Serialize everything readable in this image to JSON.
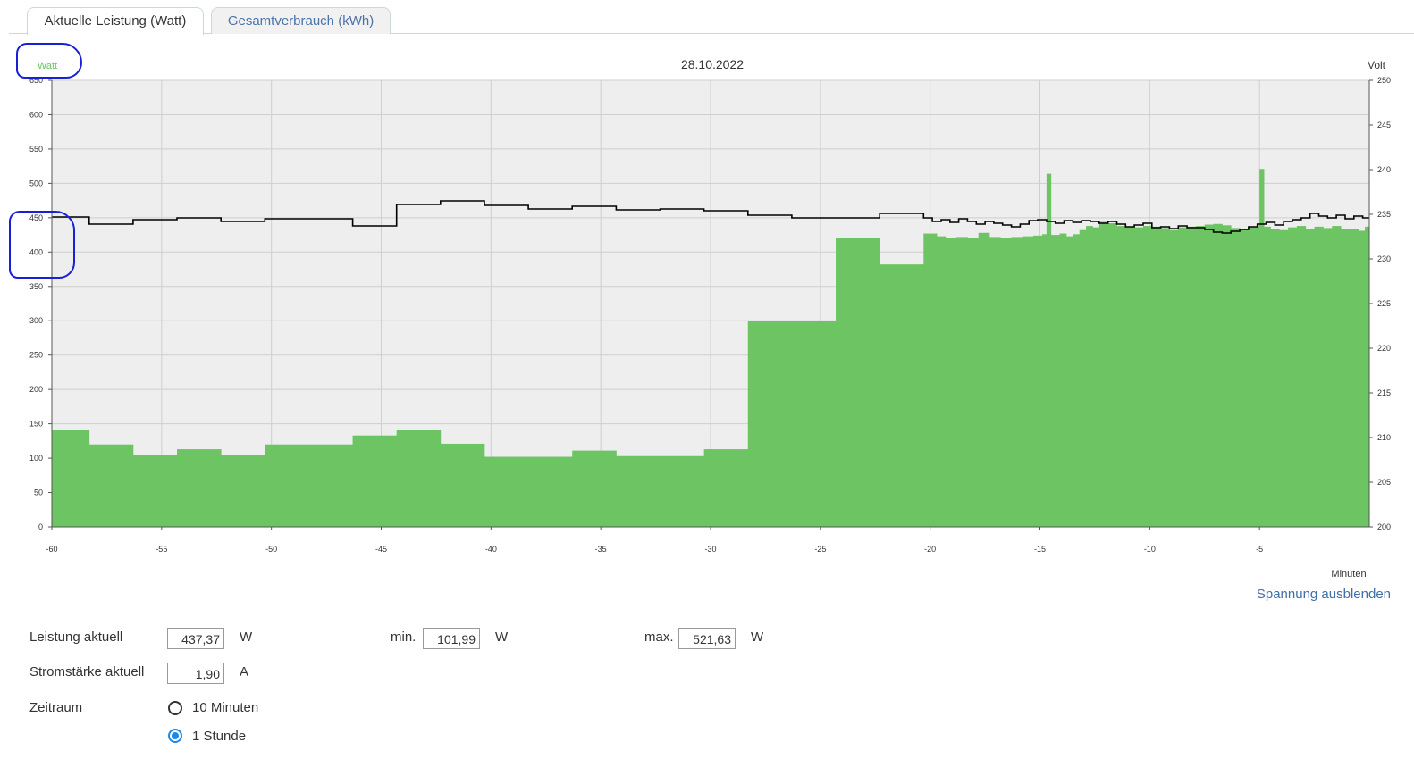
{
  "tabs": [
    {
      "label": "Aktuelle Leistung (Watt)",
      "active": true
    },
    {
      "label": "Gesamtverbrauch (kWh)",
      "active": false
    }
  ],
  "chart_data": {
    "type": "bar+line",
    "title": "28.10.2022",
    "ylabel_left": "Watt",
    "ylabel_right": "Volt",
    "xlabel": "Minuten",
    "xlim": [
      -60,
      0
    ],
    "ylim_left": [
      0,
      650
    ],
    "ylim_right": [
      200,
      250
    ],
    "x_ticks": [
      -60,
      -55,
      -50,
      -45,
      -40,
      -35,
      -30,
      -25,
      -20,
      -15,
      -10,
      -5
    ],
    "y_ticks_left": [
      0,
      50,
      100,
      150,
      200,
      250,
      300,
      350,
      400,
      450,
      500,
      550,
      600,
      650
    ],
    "y_ticks_right": [
      200,
      205,
      210,
      215,
      220,
      225,
      230,
      235,
      240,
      245,
      250
    ],
    "grid": true,
    "power_color": "#6cc463",
    "voltage_color": "#000000",
    "power_steps": [
      [
        -60,
        141
      ],
      [
        -58.3,
        120
      ],
      [
        -56.3,
        104
      ],
      [
        -54.3,
        113
      ],
      [
        -52.3,
        105
      ],
      [
        -50.3,
        120
      ],
      [
        -46.3,
        133
      ],
      [
        -44.3,
        141
      ],
      [
        -42.3,
        121
      ],
      [
        -40.3,
        102
      ],
      [
        -36.3,
        111
      ],
      [
        -34.3,
        103
      ],
      [
        -30.3,
        113
      ],
      [
        -28.3,
        300
      ],
      [
        -24.3,
        420
      ],
      [
        -22.3,
        382
      ],
      [
        -20.3,
        427
      ],
      [
        -19.7,
        423
      ],
      [
        -19.3,
        420
      ],
      [
        -18.8,
        422
      ],
      [
        -18.3,
        421
      ],
      [
        -17.8,
        428
      ],
      [
        -17.3,
        422
      ],
      [
        -16.8,
        421
      ],
      [
        -16.3,
        422
      ],
      [
        -15.8,
        423
      ],
      [
        -15.3,
        424
      ],
      [
        -14.9,
        426
      ],
      [
        -14.7,
        514
      ],
      [
        -14.5,
        425
      ],
      [
        -14.1,
        427
      ],
      [
        -13.8,
        423
      ],
      [
        -13.5,
        426
      ],
      [
        -13.2,
        432
      ],
      [
        -12.9,
        438
      ],
      [
        -12.6,
        436
      ],
      [
        -12.3,
        444
      ],
      [
        -11.9,
        442
      ],
      [
        -11.5,
        438
      ],
      [
        -11.1,
        437
      ],
      [
        -10.7,
        436
      ],
      [
        -10.3,
        438
      ],
      [
        -9.9,
        437
      ],
      [
        -9.5,
        435
      ],
      [
        -9.1,
        432
      ],
      [
        -8.7,
        436
      ],
      [
        -8.3,
        437
      ],
      [
        -7.9,
        438
      ],
      [
        -7.5,
        440
      ],
      [
        -7.1,
        441
      ],
      [
        -6.7,
        439
      ],
      [
        -6.3,
        435
      ],
      [
        -5.9,
        433
      ],
      [
        -5.5,
        436
      ],
      [
        -5.1,
        439
      ],
      [
        -5.0,
        521
      ],
      [
        -4.8,
        437
      ],
      [
        -4.5,
        434
      ],
      [
        -4.1,
        432
      ],
      [
        -3.7,
        436
      ],
      [
        -3.3,
        438
      ],
      [
        -2.9,
        433
      ],
      [
        -2.5,
        437
      ],
      [
        -2.1,
        435
      ],
      [
        -1.7,
        438
      ],
      [
        -1.3,
        434
      ],
      [
        -0.9,
        433
      ],
      [
        -0.5,
        431
      ],
      [
        -0.2,
        437
      ]
    ],
    "voltage_steps": [
      [
        -60,
        234.7
      ],
      [
        -58.3,
        233.9
      ],
      [
        -56.3,
        234.4
      ],
      [
        -54.3,
        234.6
      ],
      [
        -52.3,
        234.2
      ],
      [
        -50.3,
        234.5
      ],
      [
        -48.3,
        234.5
      ],
      [
        -46.3,
        233.7
      ],
      [
        -44.3,
        236.1
      ],
      [
        -42.3,
        236.5
      ],
      [
        -40.3,
        236.0
      ],
      [
        -38.3,
        235.6
      ],
      [
        -36.3,
        235.9
      ],
      [
        -34.3,
        235.5
      ],
      [
        -32.3,
        235.6
      ],
      [
        -30.3,
        235.4
      ],
      [
        -28.3,
        234.9
      ],
      [
        -26.3,
        234.6
      ],
      [
        -24.3,
        234.6
      ],
      [
        -22.3,
        235.1
      ],
      [
        -20.3,
        234.6
      ],
      [
        -19.9,
        234.2
      ],
      [
        -19.5,
        234.4
      ],
      [
        -19.1,
        234.1
      ],
      [
        -18.7,
        234.5
      ],
      [
        -18.3,
        234.2
      ],
      [
        -17.9,
        233.9
      ],
      [
        -17.5,
        234.2
      ],
      [
        -17.1,
        234.0
      ],
      [
        -16.7,
        233.8
      ],
      [
        -16.3,
        233.6
      ],
      [
        -15.9,
        233.9
      ],
      [
        -15.5,
        234.3
      ],
      [
        -15.1,
        234.4
      ],
      [
        -14.7,
        234.2
      ],
      [
        -14.3,
        234.0
      ],
      [
        -13.9,
        234.3
      ],
      [
        -13.5,
        234.1
      ],
      [
        -13.1,
        234.3
      ],
      [
        -12.7,
        234.2
      ],
      [
        -12.3,
        234.0
      ],
      [
        -11.9,
        234.2
      ],
      [
        -11.5,
        233.9
      ],
      [
        -11.1,
        233.6
      ],
      [
        -10.7,
        233.8
      ],
      [
        -10.3,
        234.0
      ],
      [
        -9.9,
        233.5
      ],
      [
        -9.5,
        233.6
      ],
      [
        -9.1,
        233.4
      ],
      [
        -8.7,
        233.7
      ],
      [
        -8.3,
        233.5
      ],
      [
        -7.9,
        233.5
      ],
      [
        -7.5,
        233.3
      ],
      [
        -7.1,
        233.0
      ],
      [
        -6.7,
        232.9
      ],
      [
        -6.3,
        233.1
      ],
      [
        -5.9,
        233.3
      ],
      [
        -5.5,
        233.6
      ],
      [
        -5.1,
        233.9
      ],
      [
        -4.7,
        234.1
      ],
      [
        -4.3,
        233.8
      ],
      [
        -3.9,
        234.2
      ],
      [
        -3.5,
        234.4
      ],
      [
        -3.1,
        234.6
      ],
      [
        -2.7,
        235.1
      ],
      [
        -2.3,
        234.8
      ],
      [
        -1.9,
        234.6
      ],
      [
        -1.5,
        234.9
      ],
      [
        -1.1,
        234.5
      ],
      [
        -0.7,
        234.8
      ],
      [
        -0.3,
        234.6
      ]
    ]
  },
  "controls": {
    "toggle_voltage_link": "Spannung ausblenden",
    "power_label": "Leistung aktuell",
    "power_value": "437,37",
    "power_unit": "W",
    "min_label": "min.",
    "min_value": "101,99",
    "min_unit": "W",
    "max_label": "max.",
    "max_value": "521,63",
    "max_unit": "W",
    "current_label": "Stromstärke aktuell",
    "current_value": "1,90",
    "current_unit": "A",
    "period_label": "Zeitraum",
    "period_options": [
      "10 Minuten",
      "1 Stunde"
    ],
    "period_selected": "1 Stunde"
  }
}
